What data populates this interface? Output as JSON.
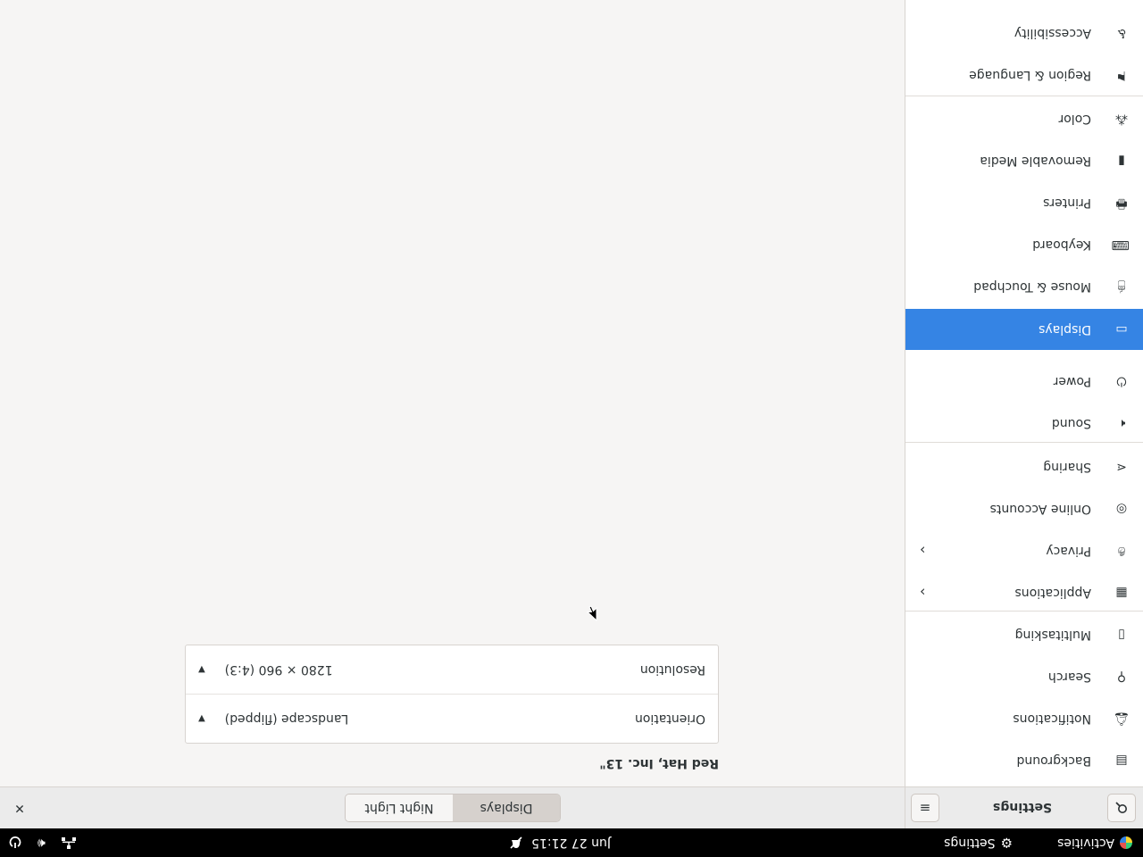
{
  "topbar": {
    "activities": "Activities",
    "app_menu": "Settings",
    "clock": "Jun 27  21:15"
  },
  "header": {
    "title": "Settings",
    "tabs": [
      {
        "label": "Displays",
        "active": true
      },
      {
        "label": "Night Light",
        "active": false
      }
    ]
  },
  "sidebar": {
    "items": [
      {
        "label": "Background",
        "icon": "background-icon"
      },
      {
        "label": "Notifications",
        "icon": "bell-icon"
      },
      {
        "label": "Search",
        "icon": "search-icon"
      },
      {
        "label": "Multitasking",
        "icon": "multitasking-icon"
      },
      {
        "label": "Applications",
        "icon": "grid-icon"
      },
      {
        "label": "Privacy",
        "icon": "hand-icon"
      },
      {
        "label": "Online Accounts",
        "icon": "at-icon"
      },
      {
        "label": "Sharing",
        "icon": "share-icon"
      },
      {
        "label": "Sound",
        "icon": "speaker-icon"
      },
      {
        "label": "Power",
        "icon": "power-icon"
      },
      {
        "label": "Displays",
        "icon": "display-icon"
      },
      {
        "label": "Mouse & Touchpad",
        "icon": "mouse-icon"
      },
      {
        "label": "Keyboard",
        "icon": "keyboard-icon"
      },
      {
        "label": "Printers",
        "icon": "printer-icon"
      },
      {
        "label": "Removable Media",
        "icon": "usb-icon"
      },
      {
        "label": "Color",
        "icon": "color-icon"
      },
      {
        "label": "Region & Language",
        "icon": "flag-icon"
      },
      {
        "label": "Accessibility",
        "icon": "accessibility-icon"
      }
    ],
    "selected": "Displays",
    "accent_color": "#3584e4"
  },
  "display": {
    "monitor_name": "Red Hat, Inc. 13\"",
    "orientation_label": "Orientation",
    "orientation_value": "Landscape (flipped)",
    "resolution_label": "Resolution",
    "resolution_value": "1280 × 960 (4:3)"
  }
}
